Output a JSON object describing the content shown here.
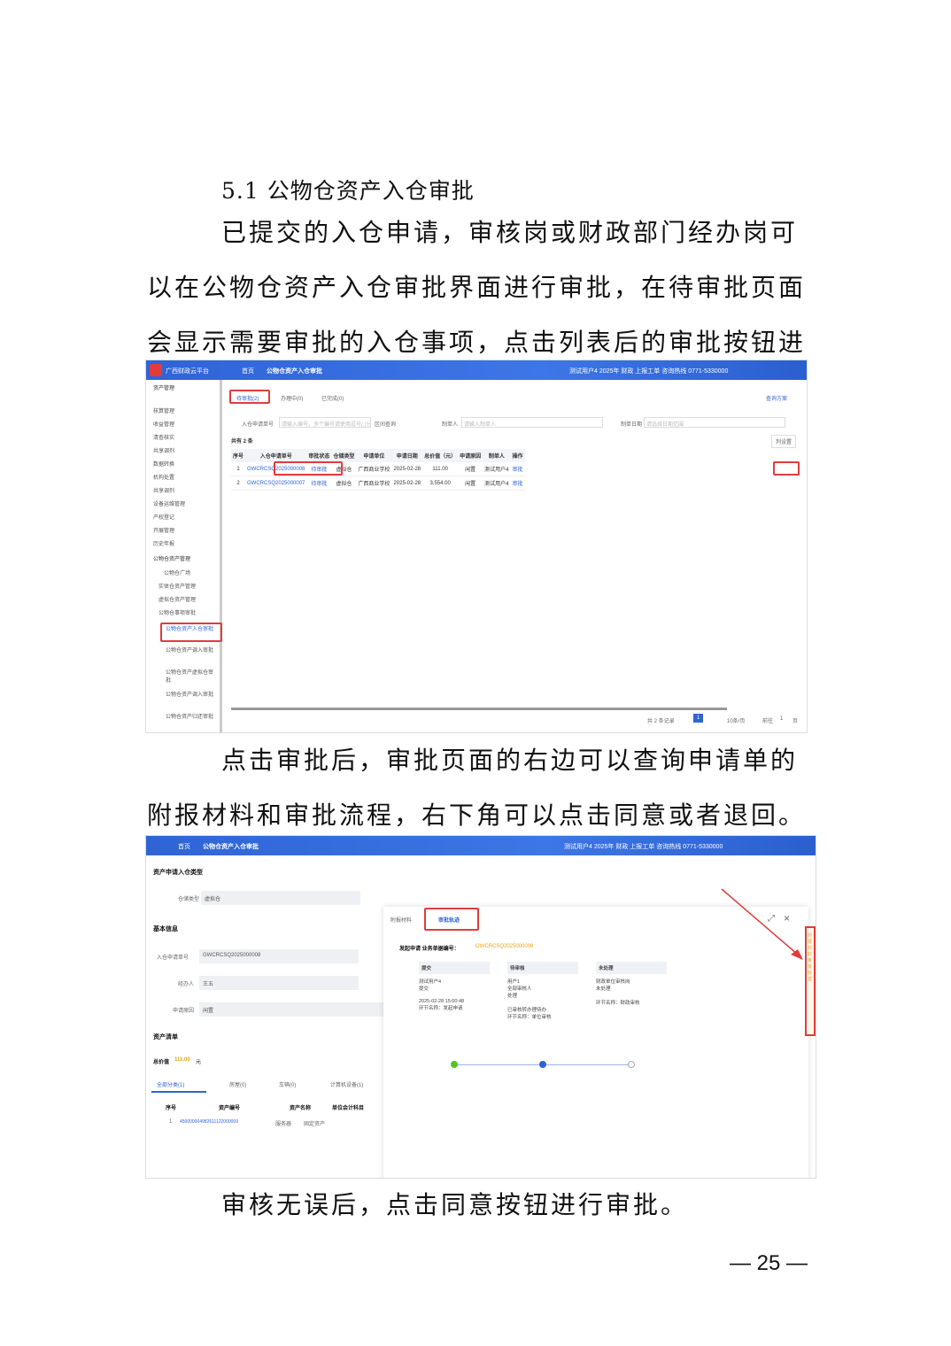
{
  "section_heading": "5.1 公物仓资产入仓审批",
  "paragraphs": [
    "已提交的入仓申请，审核岗或财政部门经办岗可以在公物仓资产入仓审批界面进行审批，在待审批页面会显示需要审批的入仓事项，点击列表后的审批按钮进行审批。",
    "点击审批后，审批页面的右边可以查询申请单的附报材料和审批流程，右下角可以点击同意或者退回。",
    "审核无误后，点击同意按钮进行审批。"
  ],
  "page_number": "— 25 —",
  "shot1": {
    "app_name": "广西财政云平台",
    "nav_home": "首页",
    "nav_tab": "公物仓资产入仓审批",
    "user_info": "测试用户4  2025年  财政  上报工单  咨询热线 0771-5330000",
    "sidebar": [
      "资产管理",
      "核算管理",
      "收益管理",
      "清查核实",
      "共享调剂",
      "数据转换",
      "机构处置",
      "共享调剂",
      "设备运维管理",
      "产权登记",
      "开展管理",
      "历史年报",
      "公物仓资产管理",
      "公物仓广场",
      "实体仓资产管理",
      "虚拟仓资产管理",
      "公物仓事项审批",
      "公物仓资产入仓审批",
      "公物仓资产调入审批",
      "公物仓资产虚拟仓审批",
      "公物仓资产调入审批",
      "公物仓资产归还审批"
    ],
    "tabs": [
      "待审批(2)",
      "办理中(0)",
      "已完成(0)"
    ],
    "query_scheme": "查询方案",
    "filters": {
      "apply_no_label": "入仓申请单号",
      "apply_no_placeholder": "请输入编号，多个编号请使用逗号(,)分隔",
      "range_label": "区间查询",
      "maker_label": "制单人",
      "maker_placeholder": "请输入制单人",
      "date_label": "制单日期",
      "date_placeholder": "请选择日期范围"
    },
    "total_text": "共有 2 条",
    "column_setting": "列设置",
    "columns": [
      "序号",
      "入仓申请单号",
      "审批状态",
      "仓储类型",
      "申请单位",
      "申请日期",
      "总价值（元）",
      "申请原因",
      "制单人",
      "操作"
    ],
    "rows": [
      [
        "1",
        "GWCRCSQ2025000008",
        "待审批",
        "虚拟仓",
        "广西商业学校",
        "2025-02-28",
        "111.00",
        "闲置",
        "测试用户4",
        "审批"
      ],
      [
        "2",
        "GWCRCSQ2025000007",
        "待审批",
        "虚拟仓",
        "广西商业学校",
        "2025-02-28",
        "3,554.00",
        "闲置",
        "测试用户4",
        "审批"
      ]
    ],
    "pager": {
      "total": "共 2 条记录",
      "page": "1",
      "page_size": "10条/页",
      "goto": "前往",
      "goto_page": "1",
      "page_unit": "页"
    }
  },
  "shot2": {
    "nav_home": "首页",
    "nav_tab": "公物仓资产入仓审批",
    "user_info": "测试用户4  2025年  财政  上报工单  咨询热线 0771-5330000",
    "section_apply": "资产申请入仓类型",
    "storage_type_label": "仓储类型",
    "storage_type_value": "虚拟仓",
    "section_basic": "基本信息",
    "apply_no_label": "入仓申请单号",
    "apply_no_value": "GWCRCSQ2025000008",
    "handler_label": "经办人",
    "handler_value": "王五",
    "reason_label": "申请原因",
    "reason_value": "闲置",
    "section_list": "资产清单",
    "total_value_label": "总价值",
    "total_value": "111.00",
    "total_value_unit": "元",
    "asset_tabs": [
      "全部分类(1)",
      "房屋(0)",
      "车辆(0)",
      "计算机设备(1)"
    ],
    "asset_columns": [
      "序号",
      "资产编号",
      "资产名称",
      "单位会计科目"
    ],
    "asset_rows": [
      [
        "1",
        "450000004982611122000009",
        "服务器",
        "固定资产"
      ]
    ],
    "panel_tabs": [
      "附报材料",
      "审批轨迹"
    ],
    "flow_title": "发起申请  业务单据编号：",
    "flow_doc_no": "GWCRCSQ2025000008",
    "cards": [
      {
        "title": "提交",
        "lines": [
          "测试用户4",
          "提交",
          "2025-02-28 15:00:48",
          "环节名称：发起申请"
        ]
      },
      {
        "title": "待审核",
        "lines": [
          "用户1",
          "全部审核人",
          "处理",
          "已审核转办理待办",
          "环节名称：单位审核"
        ]
      },
      {
        "title": "未处理",
        "lines": [
          "财政单位审核岗",
          "未处理",
          "",
          "环节名称：财政审核"
        ]
      }
    ],
    "side_tabs": "附报材料 审批轨迹"
  }
}
